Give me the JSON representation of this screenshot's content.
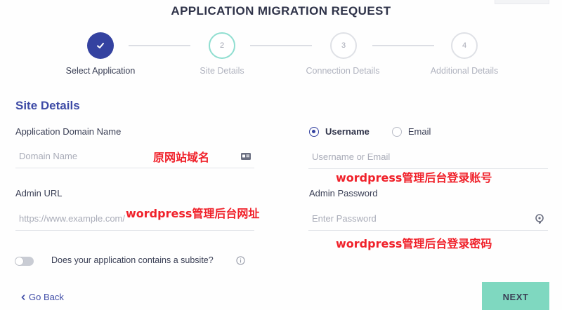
{
  "page": {
    "title": "APPLICATION MIGRATION REQUEST"
  },
  "stepper": {
    "steps": [
      {
        "number": "",
        "label": "Select Application",
        "state": "done"
      },
      {
        "number": "2",
        "label": "Site Details",
        "state": "current"
      },
      {
        "number": "3",
        "label": "Connection Details",
        "state": "pending"
      },
      {
        "number": "4",
        "label": "Additional Details",
        "state": "pending"
      }
    ]
  },
  "section": {
    "title": "Site Details"
  },
  "domain": {
    "label": "Application Domain Name",
    "placeholder": "Domain Name",
    "value": "",
    "trailing_icon": "id-card-icon"
  },
  "admin_url": {
    "label": "Admin URL",
    "placeholder": "https://www.example.com/",
    "value": ""
  },
  "credential_type": {
    "options": [
      "Username",
      "Email"
    ],
    "selected": "Username"
  },
  "username": {
    "placeholder": "Username or Email",
    "value": ""
  },
  "password": {
    "label": "Admin Password",
    "placeholder": "Enter Password",
    "value": "",
    "trailing_icon": "key-icon"
  },
  "subsite": {
    "question": "Does your application contains a subsite?",
    "enabled": false,
    "info_icon": "info-icon"
  },
  "footer": {
    "back_label": "Go Back",
    "next_label": "NEXT"
  },
  "annotations": {
    "domain_note": "原网站域名",
    "admin_url_note": "wordpress管理后台网址",
    "username_note": "wordpress管理后台登录账号",
    "password_note": "wordpress管理后台登录密码",
    "color": "#f0212a"
  },
  "colors": {
    "primary": "#3442a0",
    "accent": "#7fd8c0",
    "section_title": "#3e4ba6"
  }
}
